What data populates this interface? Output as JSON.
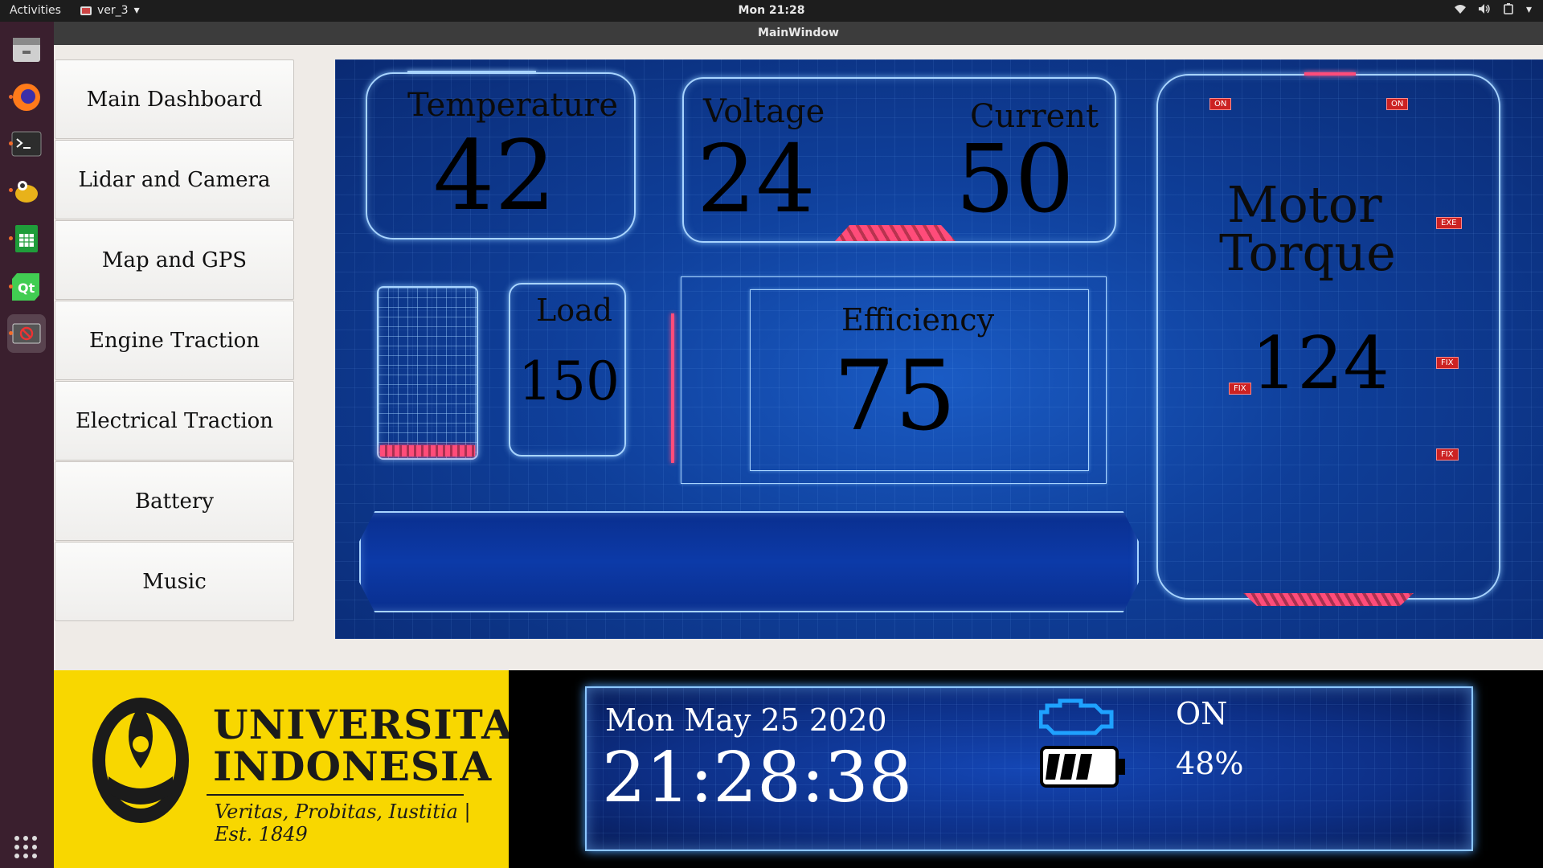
{
  "topbar": {
    "activities": "Activities",
    "app_name": "ver_3",
    "clock": "Mon 21:28"
  },
  "window": {
    "title": "MainWindow"
  },
  "dock": {
    "items": [
      "files-icon",
      "firefox-icon",
      "terminal-icon",
      "gimp-icon",
      "spreadsheet-icon",
      "qt-creator-icon",
      "app-icon"
    ]
  },
  "menu": {
    "items": [
      "Main Dashboard",
      "Lidar and Camera",
      "Map and GPS",
      "Engine Traction",
      "Electrical Traction",
      "Battery",
      "Music"
    ]
  },
  "dashboard": {
    "temperature": {
      "label": "Temperature",
      "value": "42"
    },
    "voltage": {
      "label": "Voltage",
      "value": "24"
    },
    "current": {
      "label": "Current",
      "value": "50"
    },
    "load": {
      "label": "Load",
      "value": "150"
    },
    "efficiency": {
      "label": "Efficiency",
      "value": "75"
    },
    "torque": {
      "label_line1": "Motor",
      "label_line2": "Torque",
      "value": "124"
    },
    "tags": {
      "on1": "ON",
      "on2": "ON",
      "exe": "EXE",
      "fix1": "FIX",
      "fix2": "FIX",
      "fix3": "FIX"
    }
  },
  "logo": {
    "line1": "UNIVERSITAS",
    "line2": "INDONESIA",
    "motto": "Veritas, Probitas, Iustitia | Est. 1849"
  },
  "status": {
    "date": "Mon May 25 2020",
    "time": "21:28:38",
    "engine_state": "ON",
    "battery_percent": "48%"
  },
  "colors": {
    "accent_pink": "#ff4c7a",
    "hud_blue": "#0f3f9a",
    "logo_yellow": "#f8d700"
  }
}
